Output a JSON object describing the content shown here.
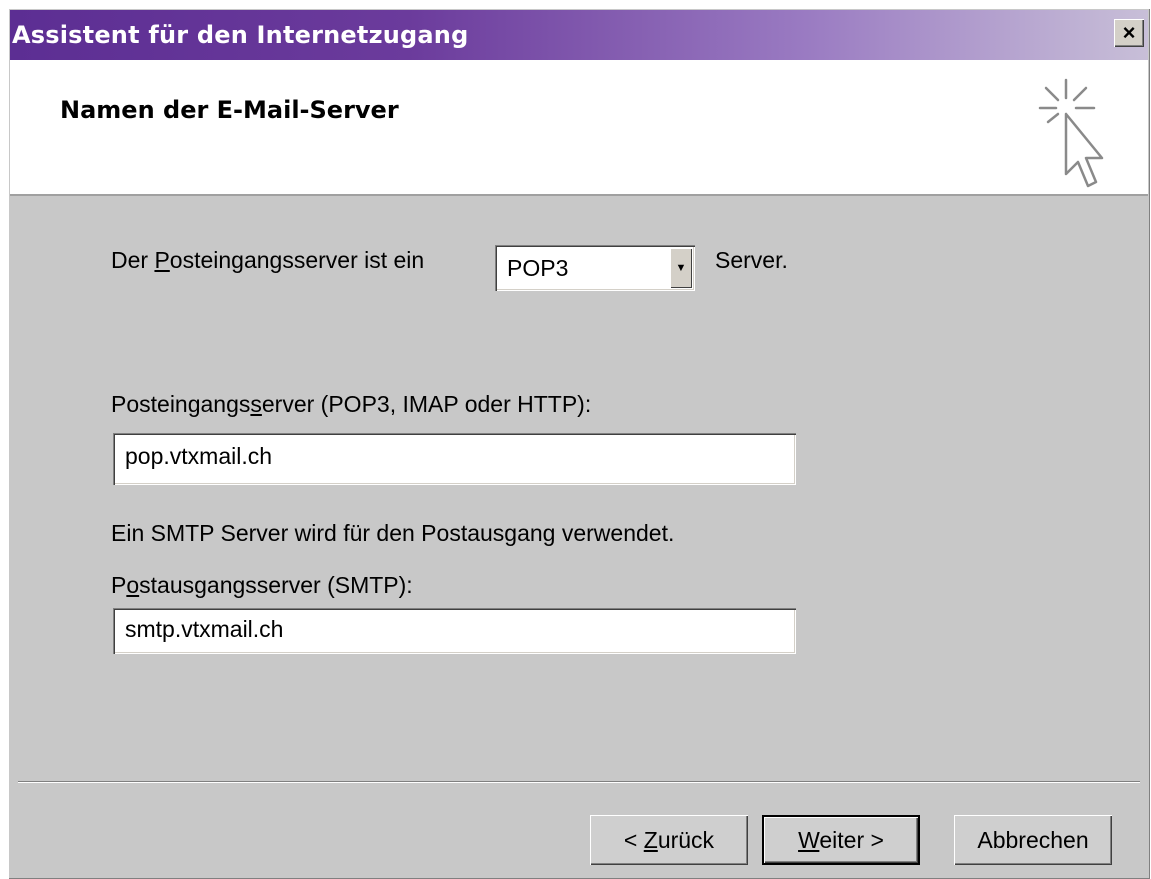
{
  "window": {
    "title": "Assistent für den Internetzugang",
    "close_label": "×"
  },
  "header": {
    "title": "Namen der E-Mail-Server",
    "icon": "wizard-cursor-icon"
  },
  "form": {
    "incoming_type_label_prefix": "Der ",
    "incoming_type_label_accel": "P",
    "incoming_type_label_rest": "osteingangsserver ist ein",
    "incoming_type_value": "POP3",
    "incoming_type_suffix": "Server.",
    "incoming_server_label_pre": "Posteingangs",
    "incoming_server_label_accel": "s",
    "incoming_server_label_post": "erver (POP3, IMAP oder HTTP):",
    "incoming_server_value": "pop.vtxmail.ch",
    "smtp_info": "Ein SMTP Server wird für den Postausgang verwendet.",
    "outgoing_server_label_pre": "P",
    "outgoing_server_label_accel": "o",
    "outgoing_server_label_post": "stausgangsserver (SMTP):",
    "outgoing_server_value": "smtp.vtxmail.ch"
  },
  "buttons": {
    "back_pre": "< ",
    "back_accel": "Z",
    "back_post": "urück",
    "next_accel": "W",
    "next_post": "eiter >",
    "cancel": "Abbrechen"
  }
}
